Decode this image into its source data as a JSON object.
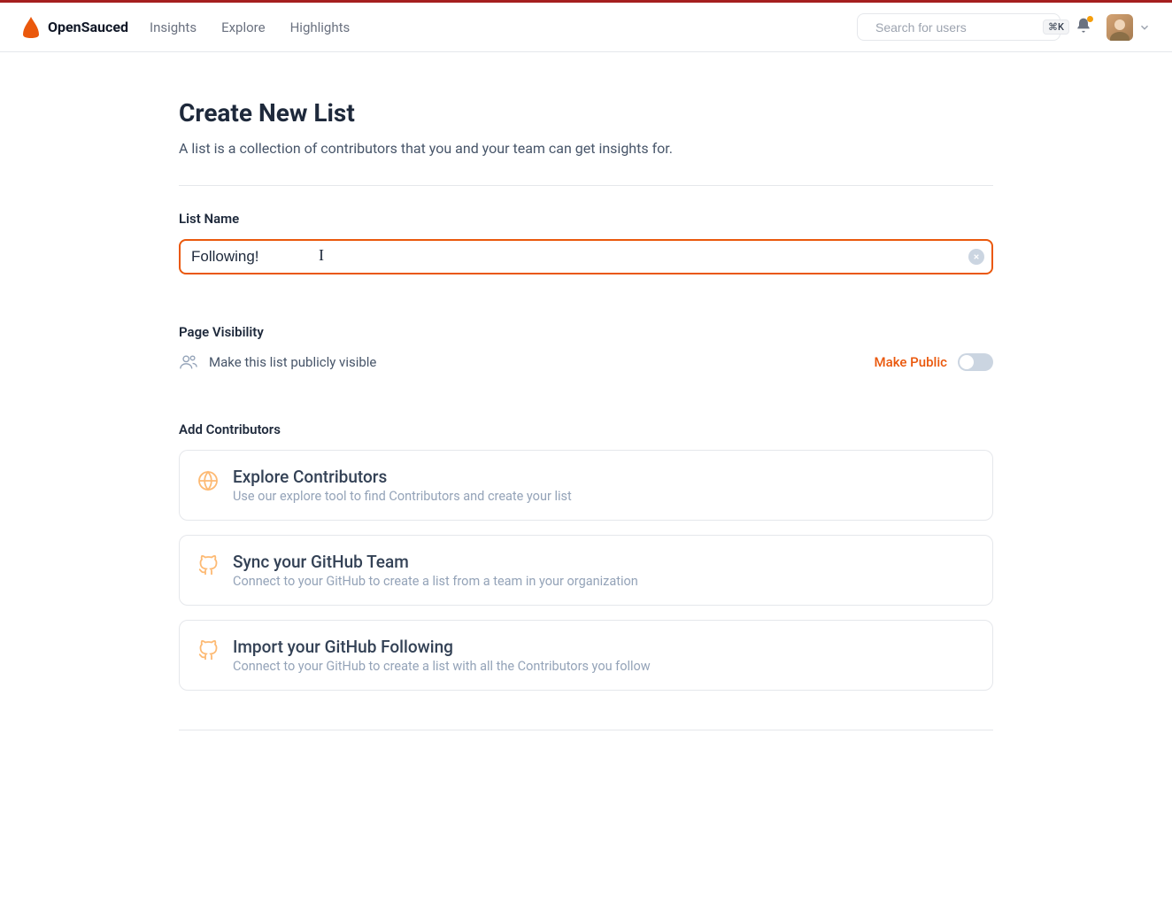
{
  "brand": {
    "name": "OpenSauced"
  },
  "nav": {
    "insights": "Insights",
    "explore": "Explore",
    "highlights": "Highlights"
  },
  "search": {
    "placeholder": "Search for users",
    "shortcut": "⌘K"
  },
  "page": {
    "title": "Create New List",
    "subtitle": "A list is a collection of contributors that you and your team can get insights for."
  },
  "listName": {
    "label": "List Name",
    "value": "Following!"
  },
  "visibility": {
    "label": "Page Visibility",
    "desc": "Make this list publicly visible",
    "toggle_label": "Make Public"
  },
  "contributors": {
    "label": "Add Contributors",
    "options": [
      {
        "title": "Explore Contributors",
        "desc": "Use our explore tool to find Contributors and create your list",
        "icon": "globe"
      },
      {
        "title": "Sync your GitHub Team",
        "desc": "Connect to your GitHub to create a list from a team in your organization",
        "icon": "github"
      },
      {
        "title": "Import your GitHub Following",
        "desc": "Connect to your GitHub to create a list with all the Contributors you follow",
        "icon": "github"
      }
    ]
  }
}
